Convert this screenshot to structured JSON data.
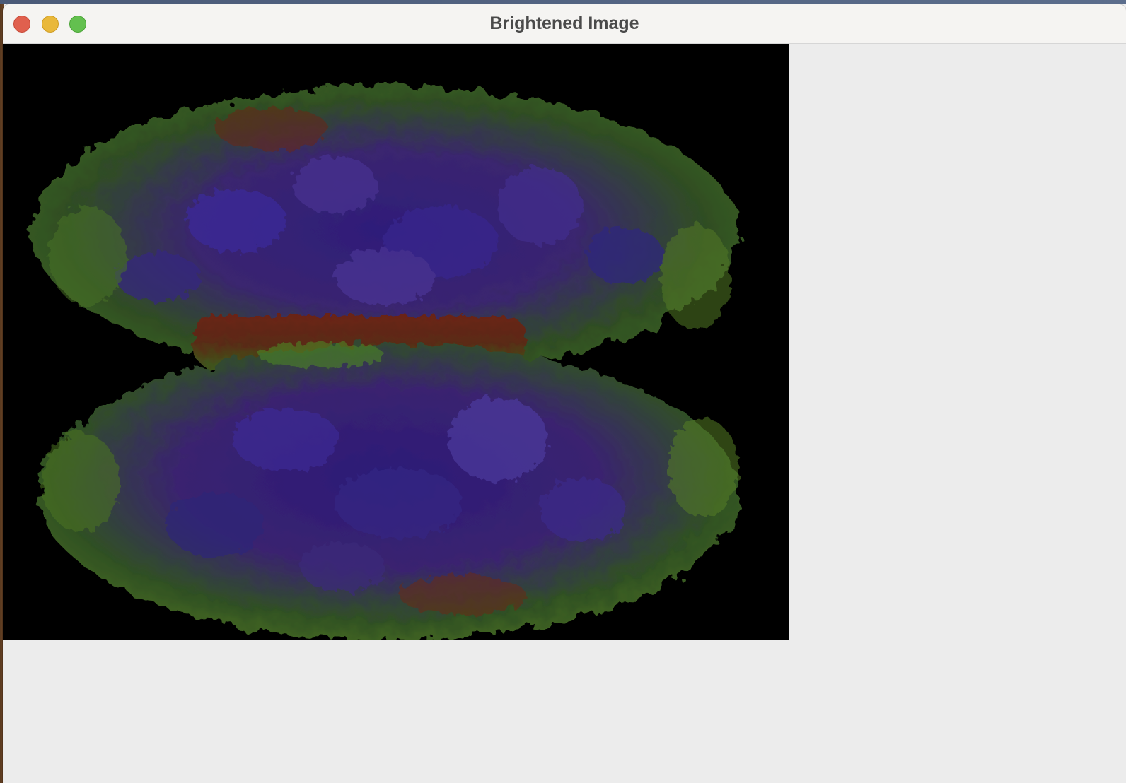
{
  "window": {
    "title": "Brightened Image",
    "controls": [
      "close-icon",
      "minimize-icon",
      "zoom-icon"
    ]
  },
  "image": {
    "description_colors": {
      "background": "#000000",
      "blue": "#3a2a9a",
      "purple": "#5a3a8a",
      "green": "#4a7a2a",
      "red": "#7a2a1a"
    }
  },
  "colors": {
    "close": "#e0604e",
    "minimize": "#e9b83a",
    "zoom": "#63c04f",
    "titlebar": "#f5f4f2",
    "window_bg": "#ececec"
  }
}
